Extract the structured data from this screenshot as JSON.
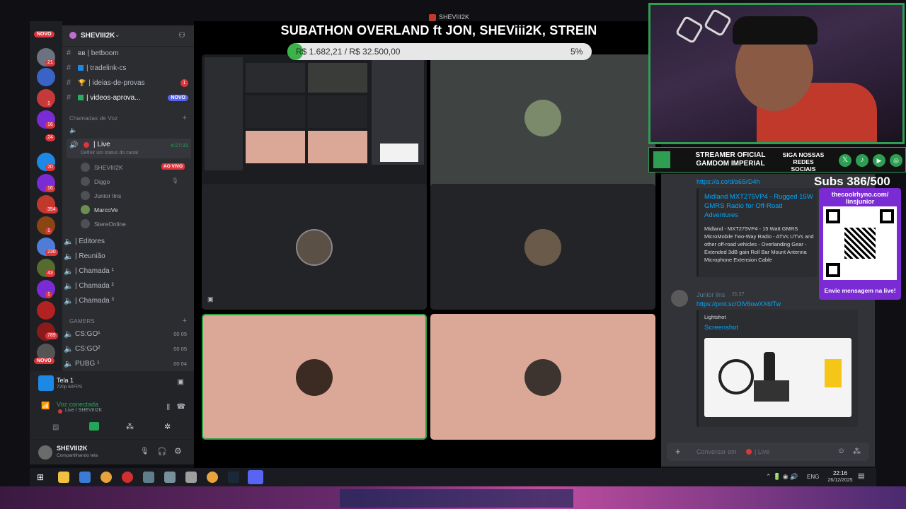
{
  "stream": {
    "tab_name": "SHEVIII2K",
    "title": "SUBATHON OVERLAND ft JON, SHEViii2K, STREIN",
    "goal_amount": "R$ 1.682,21 / R$ 32.500,00",
    "goal_percent": "5%",
    "goal_progress": 0.05,
    "subs": "Subs 386/500",
    "sponsor": "STREAMER OFICIAL GAMDOM IMPERIAL",
    "social": "SIGA NOSSAS REDES SOCIAIS",
    "qr_url": "thecoolrhyno.com/ linsjunior",
    "qr_caption": "Envie mensagem na live!"
  },
  "server_rail": {
    "top_pill": "NOVO",
    "bottom_pill": "NOVO",
    "badges": [
      "21",
      "1",
      "16",
      "24",
      "20",
      "16",
      "354",
      "1",
      "230",
      "43",
      "1",
      "789"
    ]
  },
  "sidebar": {
    "server_name": "SHEVIII2K",
    "text_channels": [
      {
        "label": "ʙʙ | betboom"
      },
      {
        "label": "| tradelink-cs"
      },
      {
        "label": "| ideias-de-provas",
        "badge": "1"
      },
      {
        "label": "| videos-aprova...",
        "badge": "NOVO"
      }
    ],
    "voice_category": "Chamadas de Voz",
    "live_channel": {
      "label": "| Live",
      "timer": "4:27:31",
      "status": "Definir um status do canal"
    },
    "live_users": [
      {
        "name": "SHEVIII2K",
        "badge": "AO VIVO"
      },
      {
        "name": "Diggo"
      },
      {
        "name": "Junior lins"
      },
      {
        "name": "MarcoVe"
      },
      {
        "name": "StereOnline"
      }
    ],
    "voice_channels": [
      "| Editores",
      "| Reunião",
      "| Chamada ¹",
      "| Chamada ²",
      "| Chamada ³"
    ],
    "gamers_category": "GAMERS",
    "gamers_channels": [
      {
        "label": "CS:GO¹",
        "a": "00",
        "b": "05"
      },
      {
        "label": "CS:GO²",
        "a": "00",
        "b": "05"
      },
      {
        "label": "PUBG ¹",
        "a": "00",
        "b": "04"
      }
    ]
  },
  "voice_panel": {
    "screen_title": "Tela 1",
    "screen_sub": "720p 60FPS",
    "connected": "Voz conectada",
    "connected_sub": "Live / SHEVIII2K",
    "user": "SHEVIII2K",
    "user_status": "Compartilhando tela"
  },
  "chat": {
    "link1": "https://a.co/d/a6SrD4h",
    "embed_title": "Midland MXT275VP4 - Rugged 15W GMRS Radio for Off-Road Adventures",
    "embed_desc": "Midland - MXT275VP4 - 15 Watt GMRS MicroMobile Two-Way Radio - ATVs UTVs and other off-road vehicles - Overlanding Gear - Extended 3dB gain Roll Bar Mount Antenna Microphone Extension Cable",
    "author": "Junior lins",
    "time": "21:27",
    "link2": "https://prnt.sc/OlV6owXX6fTw",
    "provider": "Lightshot",
    "provider_title": "Screenshot",
    "input_placeholder": "Conversar em",
    "input_channel": "| Live"
  },
  "taskbar": {
    "lang": "ENG",
    "time": "22:16",
    "date": "26/12/2025"
  },
  "colors": {
    "accent_green": "#2e9e52",
    "discord_bg": "#2b2d31",
    "tile_pink": "#dba898",
    "live_red": "#da373c"
  }
}
